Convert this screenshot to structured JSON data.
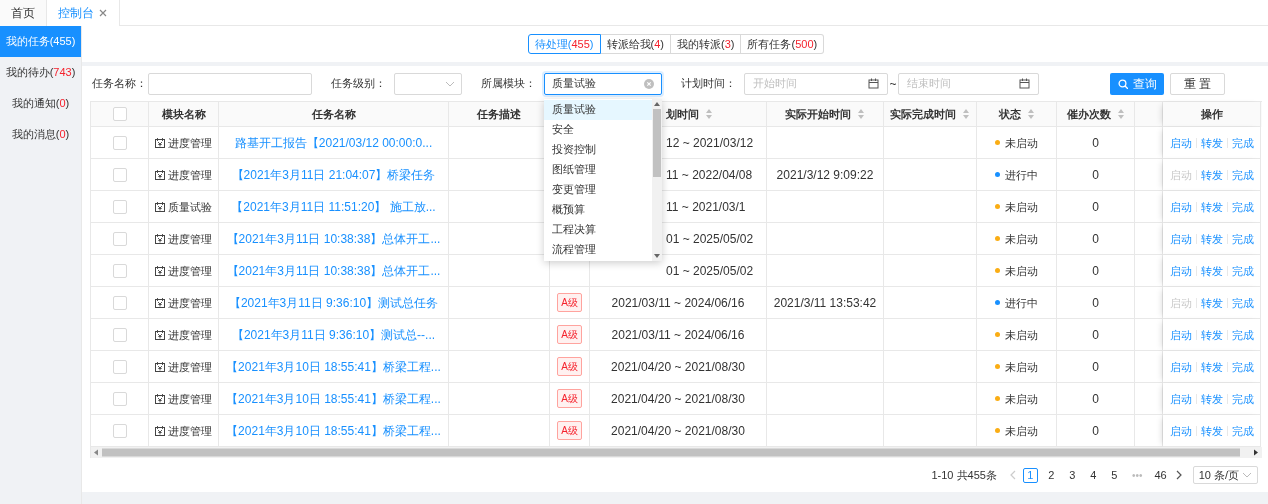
{
  "top_tabs": [
    {
      "label": "首页",
      "selected": false,
      "closable": false
    },
    {
      "label": "控制台",
      "selected": true,
      "closable": true
    }
  ],
  "sidebar": {
    "items": [
      {
        "label": "我的任务(",
        "count": "455",
        "close": ")",
        "selected": true
      },
      {
        "label": "我的待办(",
        "count": "743",
        "close": ")",
        "selected": false
      },
      {
        "label": "我的通知(",
        "count": "0",
        "close": ")",
        "selected": false
      },
      {
        "label": "我的消息(",
        "count": "0",
        "close": ")",
        "selected": false
      }
    ]
  },
  "segments": [
    {
      "label": "待处理(",
      "count": "455",
      "close": ")",
      "selected": true
    },
    {
      "label": "转派给我(",
      "count": "4",
      "close": ")",
      "selected": false
    },
    {
      "label": "我的转派(",
      "count": "3",
      "close": ")",
      "selected": false
    },
    {
      "label": "所有任务(",
      "count": "500",
      "close": ")",
      "selected": false
    }
  ],
  "filters": {
    "task_name": {
      "label": "任务名称："
    },
    "task_level": {
      "label": "任务级别："
    },
    "module": {
      "label": "所属模块：",
      "value": "质量试验",
      "focused": true,
      "options": [
        {
          "label": "质量试验",
          "selected": true
        },
        {
          "label": "安全",
          "selected": false
        },
        {
          "label": "投资控制",
          "selected": false
        },
        {
          "label": "图纸管理",
          "selected": false
        },
        {
          "label": "变更管理",
          "selected": false
        },
        {
          "label": "概预算",
          "selected": false
        },
        {
          "label": "工程决算",
          "selected": false
        },
        {
          "label": "流程管理",
          "selected": false
        }
      ]
    },
    "plan_time": {
      "label": "计划时间：",
      "start_placeholder": "开始时间",
      "separator": "~",
      "end_placeholder": "结束时间"
    },
    "search_button": "查询",
    "reset_button": "重 置"
  },
  "table": {
    "header_checked": false,
    "columns": [
      {
        "label": "模块名称",
        "sortable": false
      },
      {
        "label": "任务名称",
        "sortable": false
      },
      {
        "label": "任务描述",
        "sortable": false
      },
      {
        "label": "划时间",
        "sortable": true
      },
      {
        "label": "实际开始时间",
        "sortable": true
      },
      {
        "label": "实际完成时间",
        "sortable": true
      },
      {
        "label": "状态",
        "sortable": true
      },
      {
        "label": "催办次数",
        "sortable": true
      },
      {
        "label": "操作",
        "sortable": false
      }
    ],
    "rows": [
      {
        "checked": false,
        "module": "进度管理",
        "name": "路基开工报告【2021/03/12 00:00:0...",
        "plan": "12 ~ 2021/03/12",
        "status": "未启动",
        "color": "#faad14",
        "urge": "0",
        "actions": [
          {
            "label": "启动",
            "disabled": false
          },
          {
            "label": "转发",
            "disabled": false
          },
          {
            "label": "完成",
            "disabled": false
          }
        ]
      },
      {
        "checked": false,
        "module": "进度管理",
        "name": "【2021年3月11日 21:04:07】桥梁任务",
        "plan": "11 ~ 2022/04/08",
        "start": "2021/3/12 9:09:22",
        "status": "进行中",
        "color": "#1890ff",
        "urge": "0",
        "actions": [
          {
            "label": "启动",
            "disabled": true
          },
          {
            "label": "转发",
            "disabled": false
          },
          {
            "label": "完成",
            "disabled": false
          }
        ]
      },
      {
        "checked": false,
        "module": "质量试验",
        "name": "【2021年3月11日 11:51:20】 施工放...",
        "plan": "11 ~ 2021/03/1",
        "status": "未启动",
        "color": "#faad14",
        "urge": "0",
        "actions": [
          {
            "label": "启动",
            "disabled": false
          },
          {
            "label": "转发",
            "disabled": false
          },
          {
            "label": "完成",
            "disabled": false
          }
        ]
      },
      {
        "checked": false,
        "module": "进度管理",
        "name": "【2021年3月11日 10:38:38】总体开工...",
        "plan": "01 ~ 2025/05/02",
        "status": "未启动",
        "color": "#faad14",
        "urge": "0",
        "actions": [
          {
            "label": "启动",
            "disabled": false
          },
          {
            "label": "转发",
            "disabled": false
          },
          {
            "label": "完成",
            "disabled": false
          }
        ]
      },
      {
        "checked": false,
        "module": "进度管理",
        "name": "【2021年3月11日 10:38:38】总体开工...",
        "plan": "01 ~ 2025/05/02",
        "status": "未启动",
        "color": "#faad14",
        "urge": "0",
        "actions": [
          {
            "label": "启动",
            "disabled": false
          },
          {
            "label": "转发",
            "disabled": false
          },
          {
            "label": "完成",
            "disabled": false
          }
        ]
      },
      {
        "checked": false,
        "module": "进度管理",
        "name": "【2021年3月11日 9:36:10】测试总任务",
        "level": "A级",
        "plan": "2021/03/11 ~ 2024/06/16",
        "start": "2021/3/11 13:53:42",
        "status": "进行中",
        "color": "#1890ff",
        "urge": "0",
        "actions": [
          {
            "label": "启动",
            "disabled": true
          },
          {
            "label": "转发",
            "disabled": false
          },
          {
            "label": "完成",
            "disabled": false
          }
        ]
      },
      {
        "checked": false,
        "module": "进度管理",
        "name": "【2021年3月11日 9:36:10】测试总--...",
        "level": "A级",
        "plan": "2021/03/11 ~ 2024/06/16",
        "status": "未启动",
        "color": "#faad14",
        "urge": "0",
        "actions": [
          {
            "label": "启动",
            "disabled": false
          },
          {
            "label": "转发",
            "disabled": false
          },
          {
            "label": "完成",
            "disabled": false
          }
        ]
      },
      {
        "checked": false,
        "module": "进度管理",
        "name": "【2021年3月10日 18:55:41】桥梁工程...",
        "level": "A级",
        "plan": "2021/04/20 ~ 2021/08/30",
        "status": "未启动",
        "color": "#faad14",
        "urge": "0",
        "actions": [
          {
            "label": "启动",
            "disabled": false
          },
          {
            "label": "转发",
            "disabled": false
          },
          {
            "label": "完成",
            "disabled": false
          }
        ]
      },
      {
        "checked": false,
        "module": "进度管理",
        "name": "【2021年3月10日 18:55:41】桥梁工程...",
        "level": "A级",
        "plan": "2021/04/20 ~ 2021/08/30",
        "status": "未启动",
        "color": "#faad14",
        "urge": "0",
        "actions": [
          {
            "label": "启动",
            "disabled": false
          },
          {
            "label": "转发",
            "disabled": false
          },
          {
            "label": "完成",
            "disabled": false
          }
        ]
      },
      {
        "checked": false,
        "module": "进度管理",
        "name": "【2021年3月10日 18:55:41】桥梁工程...",
        "level": "A级",
        "plan": "2021/04/20 ~ 2021/08/30",
        "status": "未启动",
        "color": "#faad14",
        "urge": "0",
        "actions": [
          {
            "label": "启动",
            "disabled": false
          },
          {
            "label": "转发",
            "disabled": false
          },
          {
            "label": "完成",
            "disabled": false
          }
        ]
      }
    ]
  },
  "pagination": {
    "summary": "1-10 共455条",
    "prev": {
      "disabled": true
    },
    "pages": [
      {
        "label": "1",
        "selected": true
      },
      {
        "label": "2",
        "selected": false
      },
      {
        "label": "3",
        "selected": false
      },
      {
        "label": "4",
        "selected": false
      },
      {
        "label": "5",
        "selected": false
      }
    ],
    "ellipsis": "•••",
    "last_pages": [
      {
        "label": "46",
        "selected": false
      }
    ],
    "next": {
      "disabled": false
    },
    "page_size": "10 条/页"
  }
}
